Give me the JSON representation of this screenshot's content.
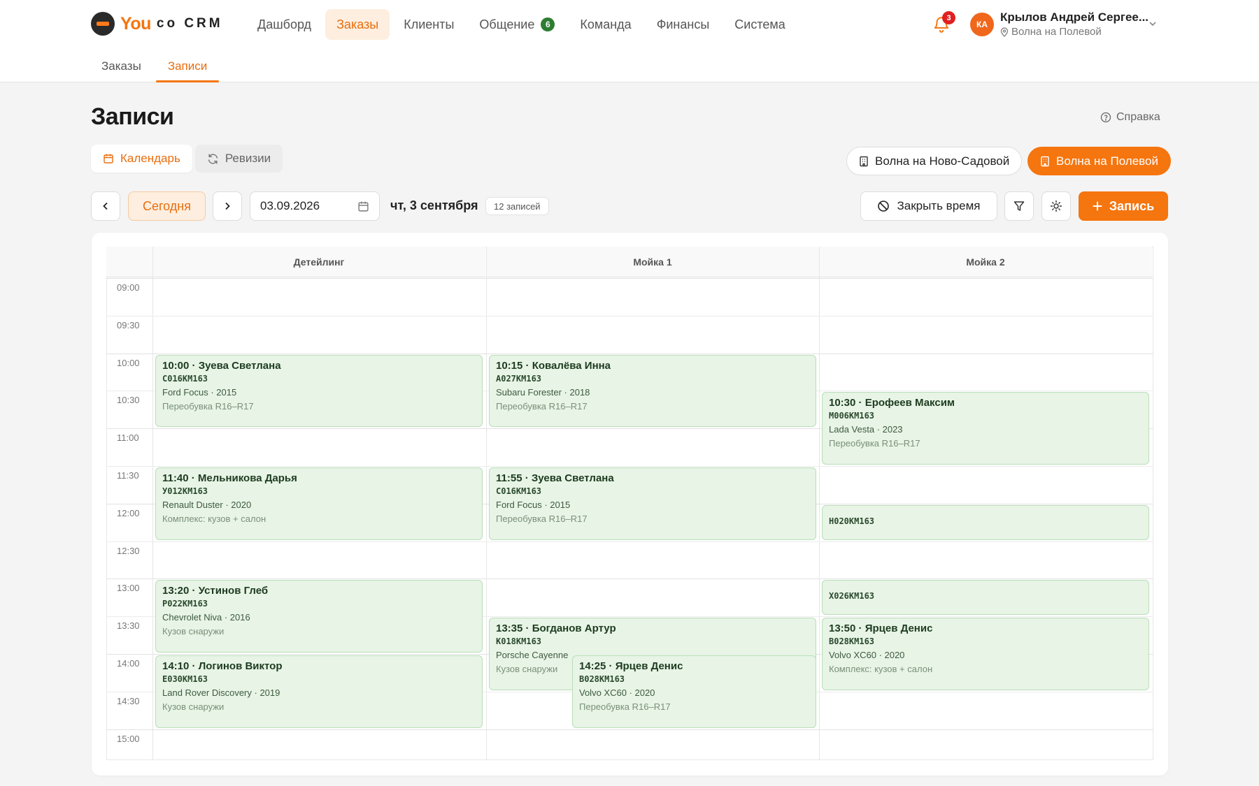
{
  "header": {
    "logo_you": "You",
    "logo_rest": "co CRM",
    "nav": [
      {
        "label": "Дашборд",
        "active": false
      },
      {
        "label": "Заказы",
        "active": true
      },
      {
        "label": "Клиенты",
        "active": false
      },
      {
        "label": "Общение",
        "active": false,
        "badge": "6"
      },
      {
        "label": "Команда",
        "active": false
      },
      {
        "label": "Финансы",
        "active": false
      },
      {
        "label": "Система",
        "active": false
      }
    ],
    "notifications_count": "3",
    "user": {
      "initials": "КА",
      "name": "Крылов Андрей Сергее...",
      "location": "Волна на Полевой"
    },
    "subtabs": [
      {
        "label": "Заказы",
        "active": false
      },
      {
        "label": "Записи",
        "active": true
      }
    ]
  },
  "page": {
    "title": "Записи",
    "help_label": "Справка",
    "view_tabs": [
      {
        "label": "Календарь",
        "icon": "calendar-icon",
        "active": true
      },
      {
        "label": "Ревизии",
        "icon": "refresh-icon",
        "active": false
      }
    ],
    "locations": [
      {
        "label": "Волна на Ново-Садовой",
        "active": false
      },
      {
        "label": "Волна на Полевой",
        "active": true
      }
    ]
  },
  "toolbar": {
    "today_label": "Сегодня",
    "date_value": "03.09.2026",
    "date_label": "чт, 3 сентября",
    "count_label": "12 записей",
    "close_time_label": "Закрыть время",
    "add_label": "Запись"
  },
  "calendar": {
    "columns": [
      "Детейлинг",
      "Мойка 1",
      "Мойка 2"
    ],
    "times": [
      "09:00",
      "09:30",
      "10:00",
      "10:30",
      "11:00",
      "11:30",
      "12:00",
      "12:30",
      "13:00",
      "13:30",
      "14:00",
      "14:30",
      "15:00"
    ],
    "events": [
      {
        "col": 0,
        "start": "10:00",
        "end": "11:00",
        "title": "10:00 · Зуева Светлана",
        "plate": "С016КМ163",
        "car": "Ford Focus · 2015",
        "service": "Переобувка R16–R17"
      },
      {
        "col": 0,
        "start": "11:30",
        "end": "12:30",
        "title": "11:40 · Мельникова Дарья",
        "plate": "У012КМ163",
        "car": "Renault Duster · 2020",
        "service": "Комплекс: кузов + салон"
      },
      {
        "col": 0,
        "start": "13:00",
        "end": "14:00",
        "title": "13:20 · Устинов Глеб",
        "plate": "Р022КМ163",
        "car": "Chevrolet Niva · 2016",
        "service": "Кузов снаружи"
      },
      {
        "col": 0,
        "start": "14:00",
        "end": "15:00",
        "title": "14:10 · Логинов Виктор",
        "plate": "Е030КМ163",
        "car": "Land Rover Discovery · 2019",
        "service": "Кузов снаружи"
      },
      {
        "col": 1,
        "start": "10:00",
        "end": "11:00",
        "title": "10:15 · Ковалёва Инна",
        "plate": "А027КМ163",
        "car": "Subaru Forester · 2018",
        "service": "Переобувка R16–R17"
      },
      {
        "col": 1,
        "start": "11:30",
        "end": "12:30",
        "title": "11:55 · Зуева Светлана",
        "plate": "С016КМ163",
        "car": "Ford Focus · 2015",
        "service": "Переобувка R16–R17"
      },
      {
        "col": 1,
        "start": "13:30",
        "end": "14:30",
        "title": "13:35 · Богданов Артур",
        "plate": "К018КМ163",
        "car": "Porsche Cayenne",
        "service": "Кузов снаружи"
      },
      {
        "col": 1,
        "start": "14:00",
        "end": "15:00",
        "offset": 0.25,
        "title": "14:25 · Ярцев Денис",
        "plate": "В028КМ163",
        "car": "Volvo XC60 · 2020",
        "service": "Переобувка R16–R17"
      },
      {
        "col": 2,
        "start": "10:30",
        "end": "11:30",
        "title": "10:30 · Ерофеев Максим",
        "plate": "М006КМ163",
        "car": "Lada Vesta · 2023",
        "service": "Переобувка R16–R17"
      },
      {
        "col": 2,
        "start": "12:00",
        "end": "12:30",
        "title": "",
        "plate": "Н020КМ163",
        "car": "",
        "service": ""
      },
      {
        "col": 2,
        "start": "13:00",
        "end": "13:30",
        "title": "",
        "plate": "Х026КМ163",
        "car": "",
        "service": ""
      },
      {
        "col": 2,
        "start": "13:30",
        "end": "14:30",
        "title": "13:50 · Ярцев Денис",
        "plate": "В028КМ163",
        "car": "Volvo XC60 · 2020",
        "service": "Комплекс: кузов + салон"
      }
    ]
  },
  "colors": {
    "accent": "#f5750f",
    "event_bg": "#e7f4e6",
    "event_border": "#b9dfb7",
    "badge_green": "#2e7d32",
    "badge_red": "#e02020"
  }
}
